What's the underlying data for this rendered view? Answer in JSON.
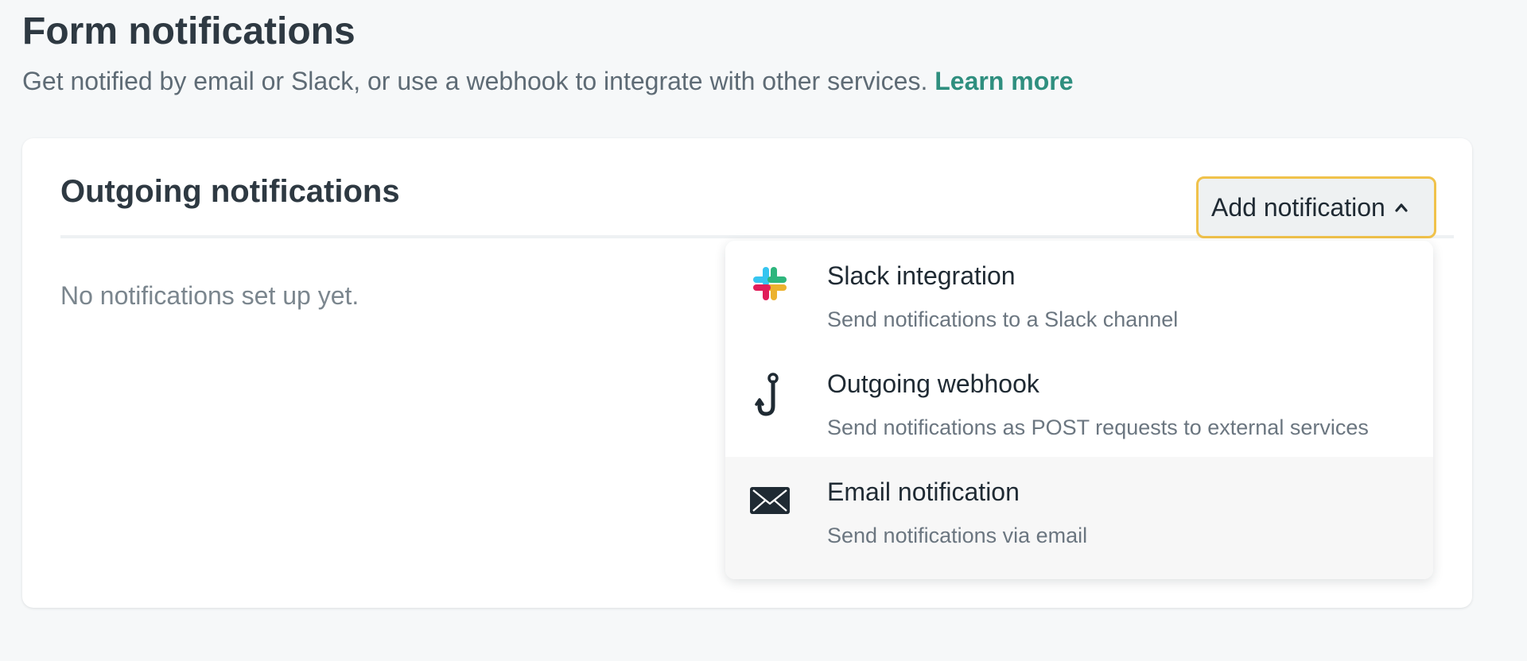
{
  "header": {
    "title": "Form notifications",
    "subtitle": "Get notified by email or Slack, or use a webhook to integrate with other services.",
    "learn_more": "Learn more"
  },
  "card": {
    "title": "Outgoing notifications",
    "empty_text": "No notifications set up yet.",
    "add_button": "Add notification"
  },
  "dropdown": {
    "items": [
      {
        "title": "Slack integration",
        "description": "Send notifications to a Slack channel",
        "icon": "slack-icon"
      },
      {
        "title": "Outgoing webhook",
        "description": "Send notifications as POST requests to external services",
        "icon": "webhook-hook-icon"
      },
      {
        "title": "Email notification",
        "description": "Send notifications via email",
        "icon": "envelope-icon"
      }
    ]
  },
  "colors": {
    "link": "#2f8f7f",
    "button_focus_border": "#f0c24b",
    "slack_blue": "#36c5f0",
    "slack_green": "#2eb67d",
    "slack_red": "#e01e5a",
    "slack_yellow": "#ecb22e"
  }
}
